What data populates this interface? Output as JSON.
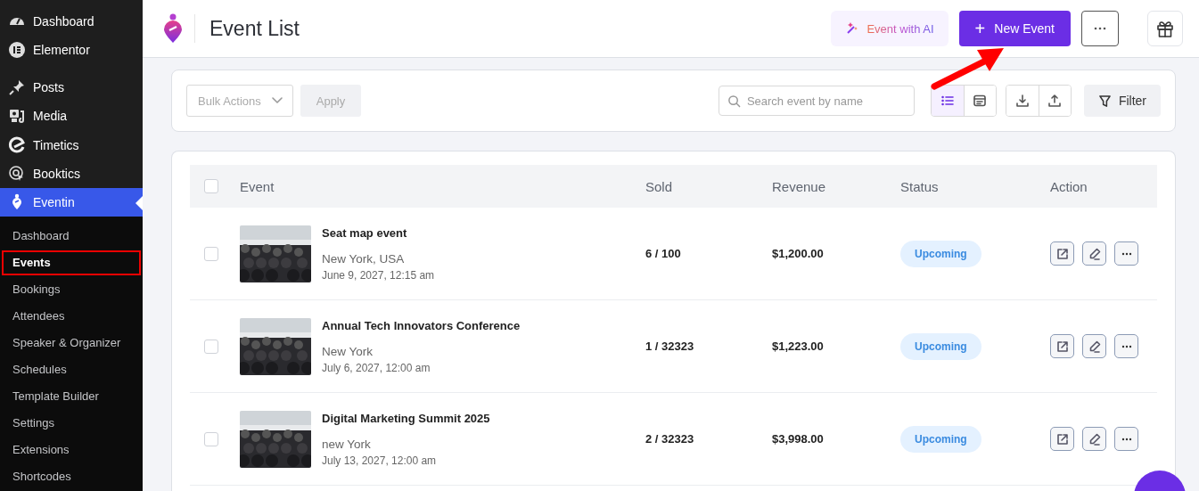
{
  "sidebar": {
    "items": [
      {
        "label": "Dashboard",
        "kind": "gauge",
        "selected": false
      },
      {
        "label": "Elementor",
        "kind": "elementor",
        "selected": false
      },
      {
        "label": "Posts",
        "kind": "pin",
        "selected": false
      },
      {
        "label": "Media",
        "kind": "media",
        "selected": false
      },
      {
        "label": "Timetics",
        "kind": "timetics",
        "selected": false
      },
      {
        "label": "Booktics",
        "kind": "booktics",
        "selected": false
      },
      {
        "label": "Eventin",
        "kind": "eventin",
        "selected": true
      }
    ],
    "submenu": [
      {
        "label": "Dashboard",
        "selected": false,
        "outlined": false
      },
      {
        "label": "Events",
        "selected": true,
        "outlined": true
      },
      {
        "label": "Bookings",
        "selected": false,
        "outlined": false
      },
      {
        "label": "Attendees",
        "selected": false,
        "outlined": false
      },
      {
        "label": "Speaker & Organizer",
        "selected": false,
        "outlined": false
      },
      {
        "label": "Schedules",
        "selected": false,
        "outlined": false
      },
      {
        "label": "Template Builder",
        "selected": false,
        "outlined": false
      },
      {
        "label": "Settings",
        "selected": false,
        "outlined": false
      },
      {
        "label": "Extensions",
        "selected": false,
        "outlined": false
      },
      {
        "label": "Shortcodes",
        "selected": false,
        "outlined": false
      }
    ]
  },
  "header": {
    "title": "Event List",
    "ai_button": "Event with AI",
    "new_button": "New Event",
    "new_icon": "+"
  },
  "toolbar": {
    "bulk": "Bulk Actions",
    "apply": "Apply",
    "search": {
      "placeholder": "Search event by name"
    },
    "views": [
      {
        "kind": "list",
        "selected": true
      },
      {
        "kind": "calendar",
        "selected": false
      }
    ],
    "filter": "Filter"
  },
  "table": {
    "all_checked": false,
    "columns": [
      "Event",
      "Sold",
      "Revenue",
      "Status",
      "Action"
    ],
    "rows": [
      {
        "checked": false,
        "title": "Seat map event",
        "location": "New York, USA",
        "date": "June 9, 2027, 12:15 am",
        "sold": "6 / 100",
        "revenue": "$1,200.00",
        "status": "Upcoming"
      },
      {
        "checked": false,
        "title": "Annual Tech Innovators Conference",
        "location": "New York",
        "date": "July 6, 2027, 12:00 am",
        "sold": "1 / 32323",
        "revenue": "$1,223.00",
        "status": "Upcoming"
      },
      {
        "checked": false,
        "title": "Digital Marketing Summit 2025",
        "location": "new York",
        "date": "July 13, 2027, 12:00 am",
        "sold": "2 / 32323",
        "revenue": "$3,998.00",
        "status": "Upcoming"
      }
    ]
  }
}
